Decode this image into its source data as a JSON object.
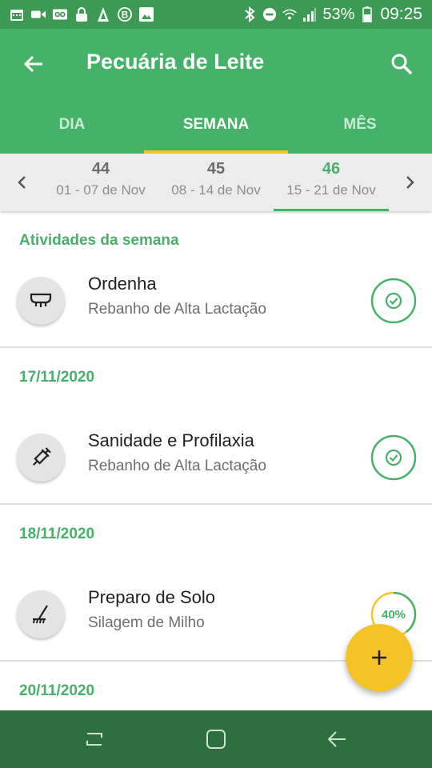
{
  "status_bar": {
    "left_icons": [
      "calendar-icon",
      "video-icon",
      "voicemail-icon",
      "lock-icon",
      "signal-tower-icon",
      "b-circle-icon",
      "image-icon"
    ],
    "battery_percent": "53%",
    "time": "09:25"
  },
  "app_bar": {
    "title": "Pecuária de Leite",
    "tabs": [
      {
        "label": "DIA",
        "active": false
      },
      {
        "label": "SEMANA",
        "active": true
      },
      {
        "label": "MÊS",
        "active": false
      }
    ]
  },
  "week_selector": {
    "weeks": [
      {
        "number": "44",
        "range": "01 - 07 de Nov",
        "active": false
      },
      {
        "number": "45",
        "range": "08 - 14 de Nov",
        "active": false
      },
      {
        "number": "46",
        "range": "15 - 21 de Nov",
        "active": true
      }
    ]
  },
  "sections": [
    {
      "header": "Atividades da semana",
      "items": [
        {
          "title": "Ordenha",
          "subtitle": "Rebanho de Alta Lactação",
          "icon": "milking-icon",
          "status": "done"
        }
      ]
    },
    {
      "header": "17/11/2020",
      "items": [
        {
          "title": "Sanidade e Profilaxia",
          "subtitle": "Rebanho de Alta Lactação",
          "icon": "syringe-icon",
          "status": "done"
        }
      ]
    },
    {
      "header": "18/11/2020",
      "items": [
        {
          "title": "Preparo de Solo",
          "subtitle": "Silagem de Milho",
          "icon": "rake-icon",
          "status": "progress",
          "progress": 0.4,
          "progress_label": "40%"
        }
      ]
    },
    {
      "header": "20/11/2020",
      "items": []
    }
  ],
  "fab": {
    "label": "+"
  },
  "colors": {
    "primary": "#45b169",
    "primary_dark": "#3d9a55",
    "accent": "#f5c326",
    "nav_bar": "#2e6f3f"
  }
}
